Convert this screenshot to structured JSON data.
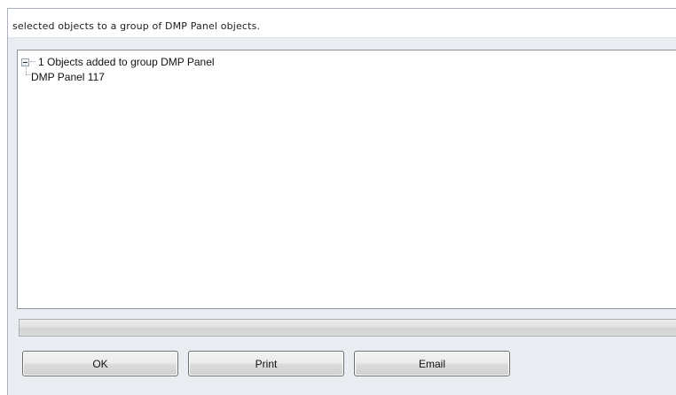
{
  "dialog": {
    "description": "selected objects to a group of DMP Panel objects."
  },
  "tree": {
    "root": {
      "label": "1 Objects added to group DMP Panel",
      "expanded": true,
      "children": [
        {
          "label": "DMP Panel 117"
        }
      ]
    }
  },
  "progress": {
    "value": 0
  },
  "buttons": {
    "ok_label": "OK",
    "print_label": "Print",
    "email_label": "Email"
  }
}
